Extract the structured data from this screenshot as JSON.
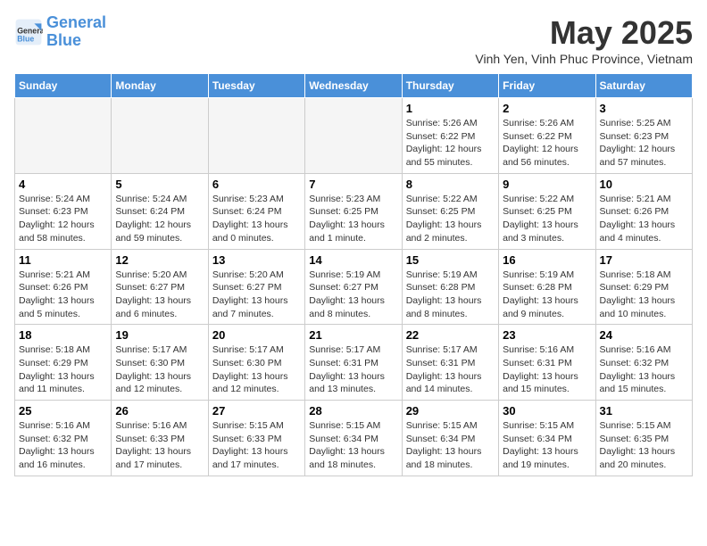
{
  "logo": {
    "line1": "General",
    "line2": "Blue"
  },
  "header": {
    "month": "May 2025",
    "location": "Vinh Yen, Vinh Phuc Province, Vietnam"
  },
  "weekdays": [
    "Sunday",
    "Monday",
    "Tuesday",
    "Wednesday",
    "Thursday",
    "Friday",
    "Saturday"
  ],
  "weeks": [
    [
      {
        "day": "",
        "info": ""
      },
      {
        "day": "",
        "info": ""
      },
      {
        "day": "",
        "info": ""
      },
      {
        "day": "",
        "info": ""
      },
      {
        "day": "1",
        "info": "Sunrise: 5:26 AM\nSunset: 6:22 PM\nDaylight: 12 hours\nand 55 minutes."
      },
      {
        "day": "2",
        "info": "Sunrise: 5:26 AM\nSunset: 6:22 PM\nDaylight: 12 hours\nand 56 minutes."
      },
      {
        "day": "3",
        "info": "Sunrise: 5:25 AM\nSunset: 6:23 PM\nDaylight: 12 hours\nand 57 minutes."
      }
    ],
    [
      {
        "day": "4",
        "info": "Sunrise: 5:24 AM\nSunset: 6:23 PM\nDaylight: 12 hours\nand 58 minutes."
      },
      {
        "day": "5",
        "info": "Sunrise: 5:24 AM\nSunset: 6:24 PM\nDaylight: 12 hours\nand 59 minutes."
      },
      {
        "day": "6",
        "info": "Sunrise: 5:23 AM\nSunset: 6:24 PM\nDaylight: 13 hours\nand 0 minutes."
      },
      {
        "day": "7",
        "info": "Sunrise: 5:23 AM\nSunset: 6:25 PM\nDaylight: 13 hours\nand 1 minute."
      },
      {
        "day": "8",
        "info": "Sunrise: 5:22 AM\nSunset: 6:25 PM\nDaylight: 13 hours\nand 2 minutes."
      },
      {
        "day": "9",
        "info": "Sunrise: 5:22 AM\nSunset: 6:25 PM\nDaylight: 13 hours\nand 3 minutes."
      },
      {
        "day": "10",
        "info": "Sunrise: 5:21 AM\nSunset: 6:26 PM\nDaylight: 13 hours\nand 4 minutes."
      }
    ],
    [
      {
        "day": "11",
        "info": "Sunrise: 5:21 AM\nSunset: 6:26 PM\nDaylight: 13 hours\nand 5 minutes."
      },
      {
        "day": "12",
        "info": "Sunrise: 5:20 AM\nSunset: 6:27 PM\nDaylight: 13 hours\nand 6 minutes."
      },
      {
        "day": "13",
        "info": "Sunrise: 5:20 AM\nSunset: 6:27 PM\nDaylight: 13 hours\nand 7 minutes."
      },
      {
        "day": "14",
        "info": "Sunrise: 5:19 AM\nSunset: 6:27 PM\nDaylight: 13 hours\nand 8 minutes."
      },
      {
        "day": "15",
        "info": "Sunrise: 5:19 AM\nSunset: 6:28 PM\nDaylight: 13 hours\nand 8 minutes."
      },
      {
        "day": "16",
        "info": "Sunrise: 5:19 AM\nSunset: 6:28 PM\nDaylight: 13 hours\nand 9 minutes."
      },
      {
        "day": "17",
        "info": "Sunrise: 5:18 AM\nSunset: 6:29 PM\nDaylight: 13 hours\nand 10 minutes."
      }
    ],
    [
      {
        "day": "18",
        "info": "Sunrise: 5:18 AM\nSunset: 6:29 PM\nDaylight: 13 hours\nand 11 minutes."
      },
      {
        "day": "19",
        "info": "Sunrise: 5:17 AM\nSunset: 6:30 PM\nDaylight: 13 hours\nand 12 minutes."
      },
      {
        "day": "20",
        "info": "Sunrise: 5:17 AM\nSunset: 6:30 PM\nDaylight: 13 hours\nand 12 minutes."
      },
      {
        "day": "21",
        "info": "Sunrise: 5:17 AM\nSunset: 6:31 PM\nDaylight: 13 hours\nand 13 minutes."
      },
      {
        "day": "22",
        "info": "Sunrise: 5:17 AM\nSunset: 6:31 PM\nDaylight: 13 hours\nand 14 minutes."
      },
      {
        "day": "23",
        "info": "Sunrise: 5:16 AM\nSunset: 6:31 PM\nDaylight: 13 hours\nand 15 minutes."
      },
      {
        "day": "24",
        "info": "Sunrise: 5:16 AM\nSunset: 6:32 PM\nDaylight: 13 hours\nand 15 minutes."
      }
    ],
    [
      {
        "day": "25",
        "info": "Sunrise: 5:16 AM\nSunset: 6:32 PM\nDaylight: 13 hours\nand 16 minutes."
      },
      {
        "day": "26",
        "info": "Sunrise: 5:16 AM\nSunset: 6:33 PM\nDaylight: 13 hours\nand 17 minutes."
      },
      {
        "day": "27",
        "info": "Sunrise: 5:15 AM\nSunset: 6:33 PM\nDaylight: 13 hours\nand 17 minutes."
      },
      {
        "day": "28",
        "info": "Sunrise: 5:15 AM\nSunset: 6:34 PM\nDaylight: 13 hours\nand 18 minutes."
      },
      {
        "day": "29",
        "info": "Sunrise: 5:15 AM\nSunset: 6:34 PM\nDaylight: 13 hours\nand 18 minutes."
      },
      {
        "day": "30",
        "info": "Sunrise: 5:15 AM\nSunset: 6:34 PM\nDaylight: 13 hours\nand 19 minutes."
      },
      {
        "day": "31",
        "info": "Sunrise: 5:15 AM\nSunset: 6:35 PM\nDaylight: 13 hours\nand 20 minutes."
      }
    ]
  ]
}
